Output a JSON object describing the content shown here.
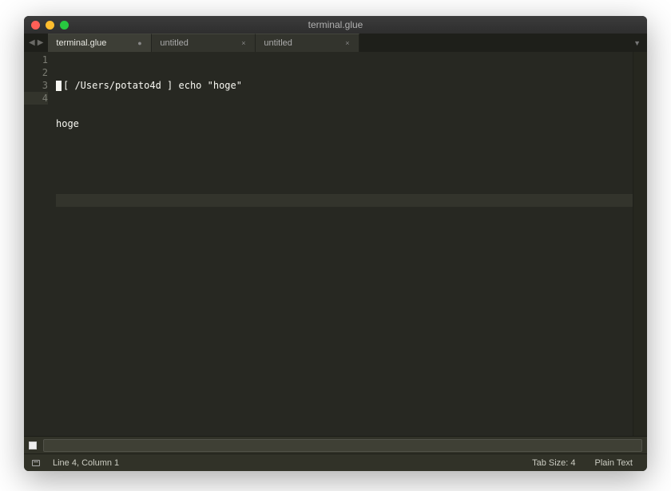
{
  "window": {
    "title": "terminal.glue"
  },
  "tabs": [
    {
      "label": "terminal.glue",
      "dirty": true,
      "active": true
    },
    {
      "label": "untitled",
      "dirty": false,
      "active": false
    },
    {
      "label": "untitled",
      "dirty": false,
      "active": false
    }
  ],
  "editor": {
    "lines": [
      "[ /Users/potato4d ] echo \"hoge\"",
      "hoge",
      "",
      ""
    ],
    "current_line_index": 3
  },
  "commandbar": {
    "value": ""
  },
  "statusbar": {
    "position": "Line 4, Column 1",
    "tabsize": "Tab Size: 4",
    "syntax": "Plain Text"
  }
}
